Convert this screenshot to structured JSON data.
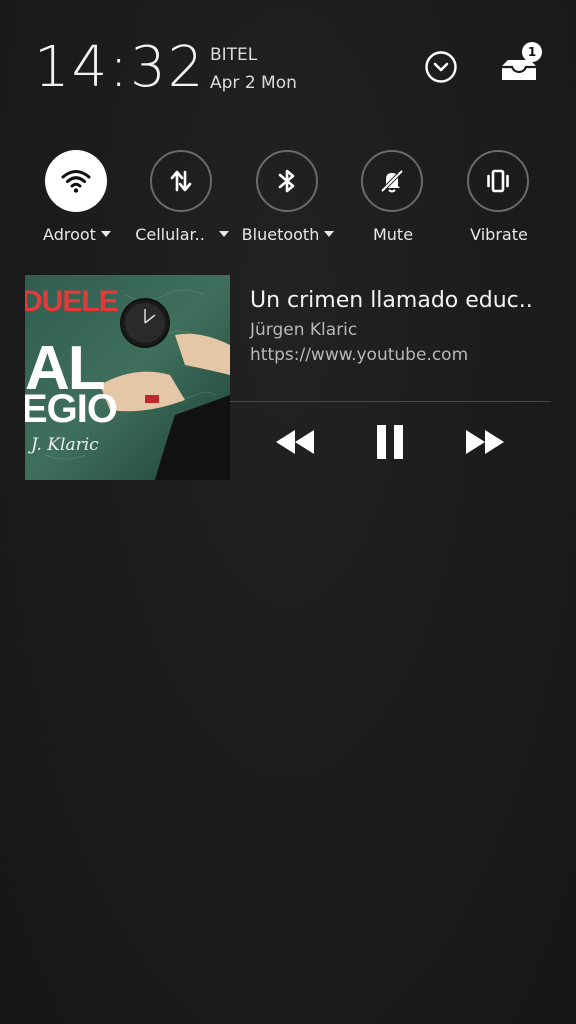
{
  "status": {
    "time": "14:32",
    "carrier": "BITEL",
    "date": "Apr 2 Mon",
    "notification_count": "1"
  },
  "quick_settings": [
    {
      "label": "Adroot",
      "icon": "wifi-icon",
      "active": true,
      "dropdown": true
    },
    {
      "label": "Cellular..",
      "icon": "data-transfer-icon",
      "active": false,
      "dropdown": true
    },
    {
      "label": "Bluetooth",
      "icon": "bluetooth-icon",
      "active": false,
      "dropdown": true
    },
    {
      "label": "Mute",
      "icon": "bell-off-icon",
      "active": false,
      "dropdown": false
    },
    {
      "label": "Vibrate",
      "icon": "vibrate-icon",
      "active": false,
      "dropdown": false
    }
  ],
  "media": {
    "title": "Un crimen llamado educ..",
    "artist": "Jürgen Klaric",
    "source": "https://www.youtube.com",
    "artwork": {
      "line1": "DUELE",
      "line2": "AL",
      "line3": "EGIO",
      "signature": "J. Klaric"
    },
    "controls": [
      "rewind-icon",
      "pause-icon",
      "fast-forward-icon"
    ]
  },
  "colors": {
    "background": "#1c1c1c",
    "active_toggle": "#ffffff",
    "inactive_toggle_border": "#6a6a6a",
    "secondary_text": "#b8b8b8"
  }
}
